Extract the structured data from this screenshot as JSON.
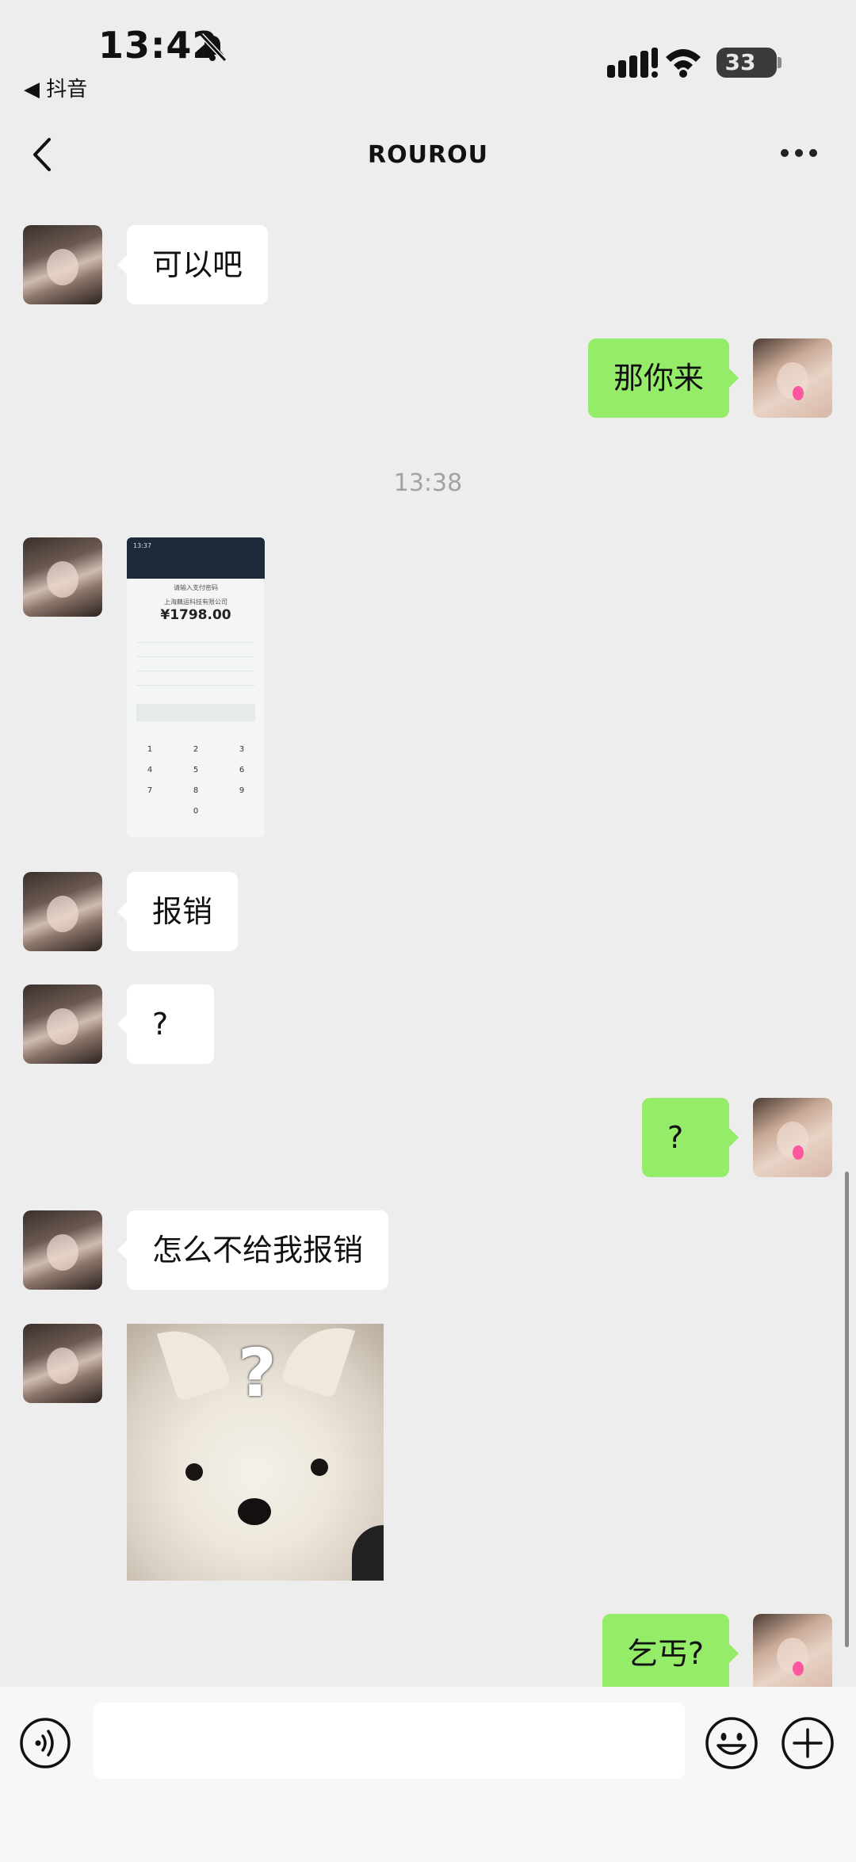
{
  "status": {
    "time": "13:42",
    "back_app": "◀ 抖音",
    "battery": "33"
  },
  "nav": {
    "title": "ROUROU"
  },
  "chat": {
    "messages": [
      {
        "side": "left",
        "type": "text",
        "text": "可以吧"
      },
      {
        "side": "right",
        "type": "text",
        "text": "那你来"
      },
      {
        "type": "timestamp",
        "text": "13:38"
      },
      {
        "side": "left",
        "type": "image",
        "image": "payment-screenshot"
      },
      {
        "side": "left",
        "type": "text",
        "text": "报销"
      },
      {
        "side": "left",
        "type": "text",
        "text": "?"
      },
      {
        "side": "right",
        "type": "text",
        "text": "?"
      },
      {
        "side": "left",
        "type": "text",
        "text": "怎么不给我报销"
      },
      {
        "side": "left",
        "type": "image",
        "image": "puppy-question-sticker"
      },
      {
        "side": "right",
        "type": "text",
        "text": "乞丐?"
      }
    ]
  },
  "shot": {
    "status_time": "13:37",
    "title": "请输入支付密码",
    "company": "上海藕运科技有限公司",
    "amount": "¥1798.00",
    "keys": [
      "1",
      "2",
      "3",
      "4",
      "5",
      "6",
      "7",
      "8",
      "9",
      "0"
    ]
  },
  "sticker": {
    "question_mark": "?"
  },
  "colors": {
    "self_bubble": "#95ec69",
    "other_bubble": "#ffffff",
    "background": "#ededed"
  },
  "icons": [
    "bell-off-icon",
    "signal-icon",
    "wifi-icon",
    "battery-icon",
    "back-icon",
    "more-icon",
    "voice-icon",
    "emoji-icon",
    "plus-icon"
  ]
}
